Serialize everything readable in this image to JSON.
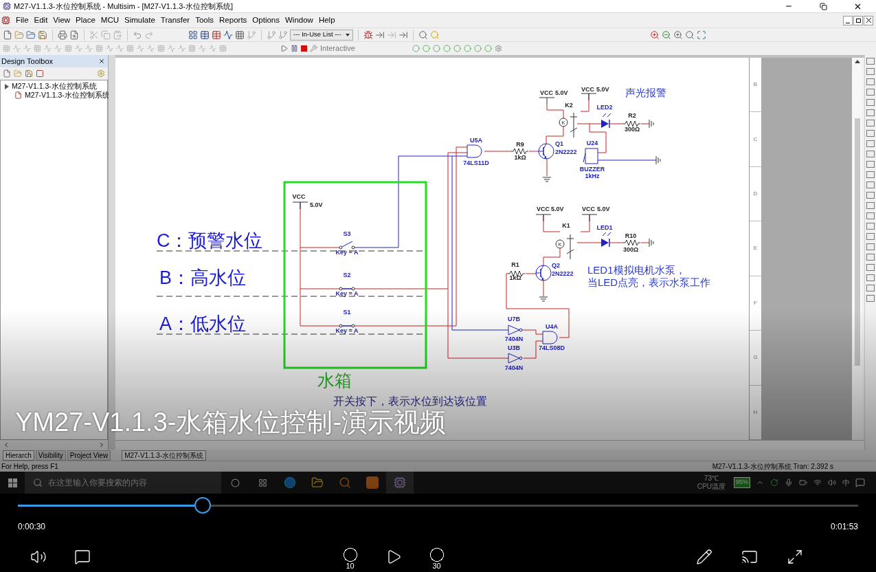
{
  "window": {
    "title": "M27-V1.1.3-水位控制系统 - Multisim - [M27-V1.1.3-水位控制系统]"
  },
  "menu": [
    "File",
    "Edit",
    "View",
    "Place",
    "MCU",
    "Simulate",
    "Transfer",
    "Tools",
    "Reports",
    "Options",
    "Window",
    "Help"
  ],
  "toolbar": {
    "in_use_list": "--- In-Use List ---",
    "sim_mode": "Interactive",
    "running": true
  },
  "design_toolbox": {
    "title": "Design Toolbox",
    "tree": [
      {
        "label": "M27-V1.1.3-水位控制系统",
        "expanded": true,
        "children": [
          {
            "label": "M27-V1.1.3-水位控制系统"
          }
        ]
      }
    ],
    "tabs": [
      {
        "label": "Hierarch",
        "selected": true
      },
      {
        "label": "Visibility",
        "selected": false
      },
      {
        "label": "Project View",
        "selected": false
      }
    ]
  },
  "sheet_tab": "M27-V1.1.3-水位控制系统",
  "schematic": {
    "annotations": [
      {
        "kind": "note",
        "text": "声光报警"
      },
      {
        "kind": "level",
        "text": "C：预警水位"
      },
      {
        "kind": "level",
        "text": "B：高水位"
      },
      {
        "kind": "note",
        "text": "LED1模拟电机水泵，"
      },
      {
        "kind": "note",
        "text": "当LED点亮，表示水泵工作"
      },
      {
        "kind": "level",
        "text": "A：低水位"
      },
      {
        "kind": "tank",
        "text": "水箱"
      },
      {
        "kind": "caption",
        "text": "开关按下，表示水位到达该位置"
      }
    ],
    "parts": [
      {
        "kind": "vcc",
        "labels": [
          "VCC",
          "5.0V"
        ]
      },
      {
        "kind": "vcc",
        "labels": [
          "VCC",
          "5.0V"
        ]
      },
      {
        "kind": "relay",
        "coil_mark": "K",
        "labels": [
          "K2"
        ]
      },
      {
        "kind": "led",
        "lit": false,
        "labels": [
          "LED2"
        ]
      },
      {
        "kind": "resistor",
        "labels": [
          "R2",
          "300Ω"
        ]
      },
      {
        "kind": "and",
        "labels": [
          "U5A",
          "74LS11D"
        ]
      },
      {
        "kind": "resistor",
        "labels": [
          "R9",
          "1kΩ"
        ]
      },
      {
        "kind": "transistor",
        "labels": [
          "Q1",
          "2N2222"
        ]
      },
      {
        "kind": "buzzer",
        "labels": [
          "U24",
          "BUZZER",
          "1kHz"
        ]
      },
      {
        "kind": "vcc",
        "labels": [
          "VCC",
          "5.0V"
        ]
      },
      {
        "kind": "vcc",
        "labels": [
          "VCC",
          "5.0V"
        ]
      },
      {
        "kind": "vcc",
        "labels": [
          "VCC",
          "5.0V"
        ]
      },
      {
        "kind": "switch",
        "closed": false,
        "labels": [
          "S3",
          "Key = A"
        ]
      },
      {
        "kind": "relay",
        "coil_mark": "K",
        "labels": [
          "K1"
        ]
      },
      {
        "kind": "led",
        "lit": false,
        "labels": [
          "LED1"
        ]
      },
      {
        "kind": "resistor",
        "labels": [
          "R10",
          "300Ω"
        ]
      },
      {
        "kind": "resistor",
        "labels": [
          "R1",
          "1kΩ"
        ]
      },
      {
        "kind": "transistor",
        "labels": [
          "Q2",
          "2N2222"
        ]
      },
      {
        "kind": "switch",
        "closed": true,
        "labels": [
          "S2",
          "Key = A"
        ]
      },
      {
        "kind": "switch",
        "closed": true,
        "labels": [
          "S1",
          "Key = A"
        ]
      },
      {
        "kind": "not",
        "labels": [
          "U7B",
          "7404N"
        ]
      },
      {
        "kind": "and",
        "labels": [
          "U4A",
          "74LS08D"
        ]
      },
      {
        "kind": "not",
        "labels": [
          "U3B",
          "7404N"
        ]
      }
    ],
    "row_labels": [
      "B",
      "C",
      "D",
      "E",
      "F",
      "G",
      "H"
    ]
  },
  "status_bar": {
    "help": "For Help, press F1",
    "sim": "M27-V1.1.3-水位控制系统 Tran: 2.392 s"
  },
  "subtitle": "YM27-V1.1.3-水箱水位控制-演示视频",
  "taskbar": {
    "search_placeholder": "在这里输入你要搜索的内容",
    "temp": "73℃",
    "temp_label": "CPU温度",
    "battery": "95%",
    "ime": "中"
  },
  "player": {
    "level": 0.22,
    "elapsed": "0:00:30",
    "duration": "0:01:53",
    "playing": false,
    "rewind": "10",
    "forward": "30"
  }
}
